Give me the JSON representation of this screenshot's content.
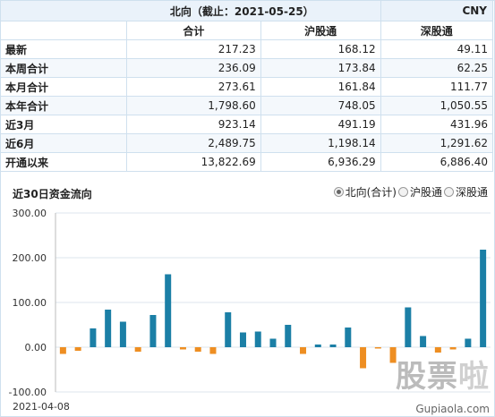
{
  "summary": {
    "title": "北向（截止：2021-05-25）",
    "currency": "CNY",
    "columns": [
      "合计",
      "沪股通",
      "深股通"
    ],
    "rows": [
      {
        "label": "最新",
        "values": [
          "217.23",
          "168.12",
          "49.11"
        ]
      },
      {
        "label": "本周合计",
        "values": [
          "236.09",
          "173.84",
          "62.25"
        ]
      },
      {
        "label": "本月合计",
        "values": [
          "273.61",
          "161.84",
          "111.77"
        ]
      },
      {
        "label": "本年合计",
        "values": [
          "1,798.60",
          "748.05",
          "1,050.55"
        ]
      },
      {
        "label": "近3月",
        "values": [
          "923.14",
          "491.19",
          "431.96"
        ]
      },
      {
        "label": "近6月",
        "values": [
          "2,489.75",
          "1,198.14",
          "1,291.62"
        ]
      },
      {
        "label": "开通以来",
        "values": [
          "13,822.69",
          "6,936.29",
          "6,886.40"
        ]
      }
    ]
  },
  "chart_section": {
    "title": "近30日资金流向",
    "legend": [
      {
        "label": "北向(合计)",
        "selected": true
      },
      {
        "label": "沪股通",
        "selected": false
      },
      {
        "label": "深股通",
        "selected": false
      }
    ]
  },
  "colors": {
    "positive": "#1b7fa6",
    "negative": "#ee8e22",
    "grid": "#dde6ee",
    "border": "#cfe0ee"
  },
  "chart_data": {
    "type": "bar",
    "title": "近30日资金流向",
    "ylim": [
      -100,
      300
    ],
    "yticks": [
      "300.00",
      "200.00",
      "100.00",
      "0.00",
      "-100.00"
    ],
    "ytick_values": [
      300,
      200,
      100,
      0,
      -100
    ],
    "x_first_label": "2021-04-08",
    "values": [
      -15,
      -8,
      42,
      84,
      57,
      -10,
      72,
      163,
      -5,
      -10,
      -15,
      78,
      33,
      35,
      19,
      50,
      -15,
      6,
      6,
      44,
      -47,
      -3,
      -35,
      89,
      25,
      -12,
      -5,
      19,
      218
    ]
  },
  "watermark": {
    "text_a": "股票",
    "text_b": "啦",
    "url": "Gupiaola.com"
  }
}
